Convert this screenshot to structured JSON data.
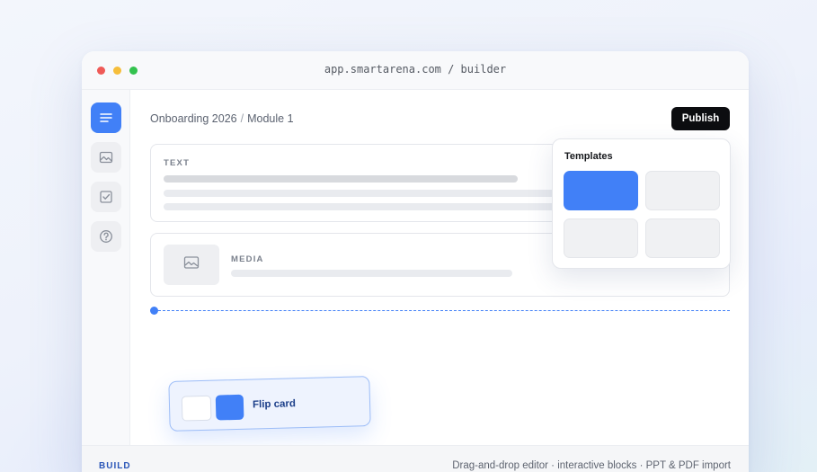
{
  "window": {
    "url": "app.smartarena.com / builder"
  },
  "sidebar": {
    "items": [
      {
        "icon": "text-lines-icon",
        "active": true
      },
      {
        "icon": "image-icon",
        "active": false
      },
      {
        "icon": "checkbox-icon",
        "active": false
      },
      {
        "icon": "help-circle-icon",
        "active": false
      }
    ]
  },
  "header": {
    "breadcrumb": [
      "Onboarding 2026",
      "Module 1"
    ],
    "breadcrumb_separator": "/",
    "publish_label": "Publish"
  },
  "blocks": {
    "text_label": "TEXT",
    "media_label": "MEDIA"
  },
  "templates": {
    "title": "Templates"
  },
  "drag_card": {
    "label": "Flip card"
  },
  "footer": {
    "tag": "BUILD",
    "description": "Drag-and-drop editor · interactive blocks · PPT & PDF import"
  },
  "colors": {
    "accent": "#4180f7",
    "publish_bg": "#0c0d10"
  }
}
